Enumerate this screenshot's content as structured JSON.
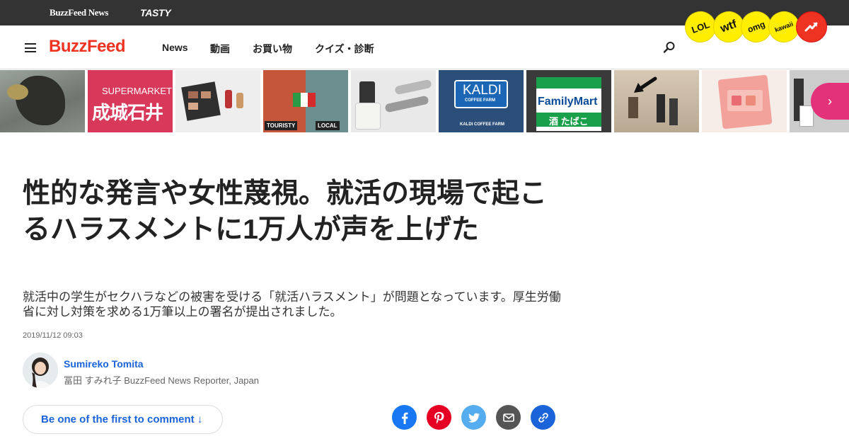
{
  "top_bar": {
    "buzzfeed_news": "BuzzFeed News",
    "tasty": "TASTY"
  },
  "badges": [
    {
      "label": "LOL"
    },
    {
      "label": "wtf"
    },
    {
      "label": "omg"
    },
    {
      "label": "kawaii"
    }
  ],
  "header": {
    "logo": "BuzzFeed",
    "nav": [
      "News",
      "動画",
      "お買い物",
      "クイズ・診断"
    ]
  },
  "carousel": {
    "supermarket": "SUPERMARKET",
    "seijo": "成城石井",
    "touristy": "TOURISTY",
    "local": "LOCAL",
    "kaldi": "KALDI",
    "kaldi_sub": "COFFEE FARM",
    "kaldi_sign": "KALDI COFFEE FARM",
    "familymart": "FamilyMart",
    "familymart_sub": "酒 たばこ",
    "next_symbol": "›"
  },
  "article": {
    "headline": "性的な発言や女性蔑視。就活の現場で起こるハラスメントに1万人が声を上げた",
    "dek": "就活中の学生がセクハラなどの被害を受ける「就活ハラスメント」が問題となっています。厚生労働省に対し対策を求める1万筆以上の署名が提出されました。",
    "timestamp": "2019/11/12 09:03",
    "author_name": "Sumireko Tomita",
    "author_title": "冨田 すみれ子 BuzzFeed News Reporter, Japan",
    "comment_button": "Be one of the first to comment ↓"
  },
  "colors": {
    "brand_red": "#ee3322",
    "link_blue": "#1a63d8",
    "badge_yellow": "#ffee00",
    "carousel_pink": "#e4327a"
  }
}
